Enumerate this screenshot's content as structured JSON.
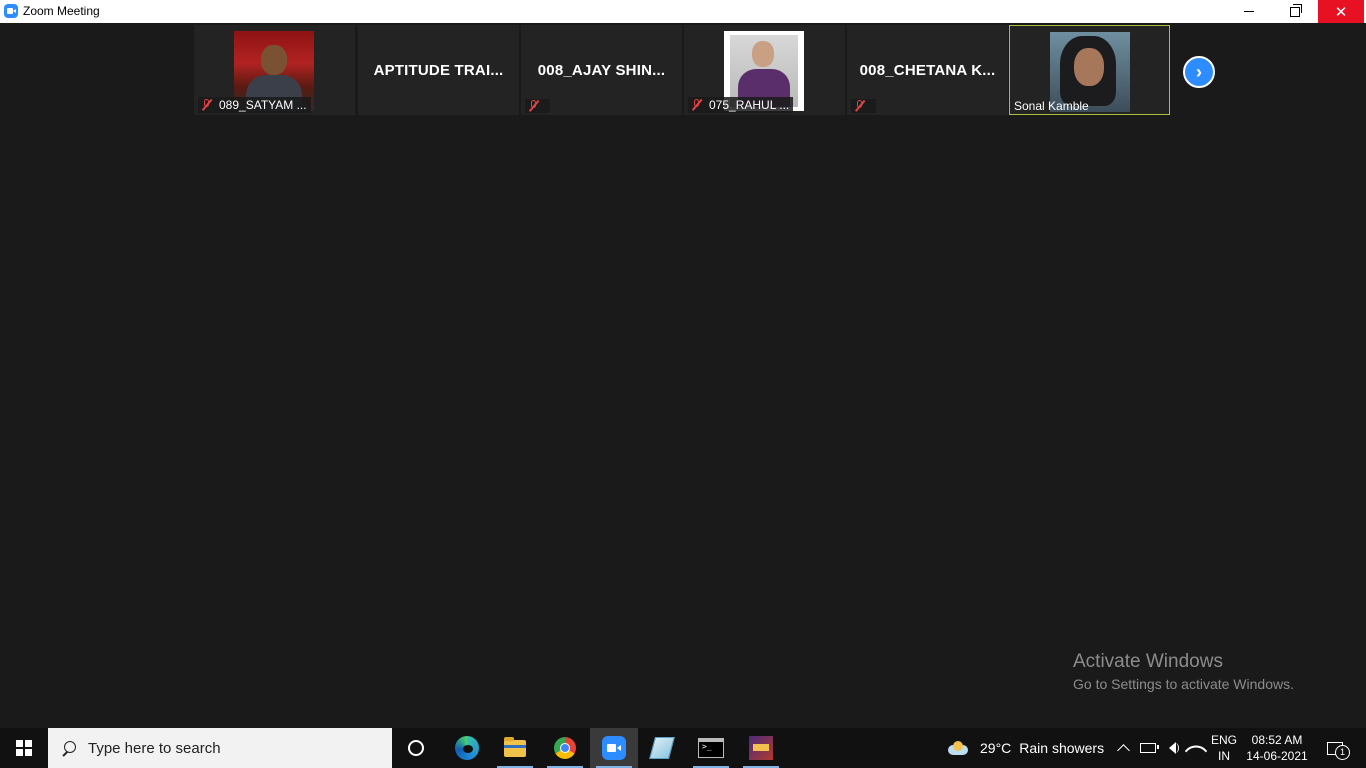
{
  "window": {
    "title": "Zoom Meeting",
    "controls": {
      "minimize": "minimize",
      "maximize": "restore",
      "close": "✕"
    }
  },
  "participants": [
    {
      "label": "089_SATYAM ...",
      "muted": true,
      "has_photo": true
    },
    {
      "label": "APTITUDE TRAI...",
      "muted": false,
      "has_photo": false
    },
    {
      "label": "008_AJAY SHIN...",
      "muted": true,
      "has_photo": false
    },
    {
      "label": "075_RAHUL ...",
      "muted": true,
      "has_photo": true
    },
    {
      "label": "008_CHETANA K...",
      "muted": true,
      "has_photo": false
    },
    {
      "label": "Sonal Kamble",
      "muted": false,
      "has_photo": true,
      "active_speaker": true
    }
  ],
  "strip": {
    "next_icon": "chevron-right-icon",
    "next_glyph": "›"
  },
  "watermark": {
    "title": "Activate Windows",
    "subtitle": "Go to Settings to activate Windows."
  },
  "taskbar": {
    "search_placeholder": "Type here to search",
    "pinned": [
      "task-view",
      "edge",
      "file-explorer",
      "chrome",
      "zoom",
      "notepad",
      "command-prompt",
      "game"
    ],
    "weather": {
      "temp": "29°C",
      "condition": "Rain showers"
    },
    "language": {
      "line1": "ENG",
      "line2": "IN"
    },
    "clock": {
      "time": "08:52 AM",
      "date": "14-06-2021"
    },
    "notifications_count": "1"
  },
  "colors": {
    "meeting_bg": "#1a1a1a",
    "tile_bg": "#232323",
    "active_border": "#a6c13c",
    "muted_red": "#e04343",
    "zoom_blue": "#2d8cff",
    "close_red": "#e81123"
  }
}
